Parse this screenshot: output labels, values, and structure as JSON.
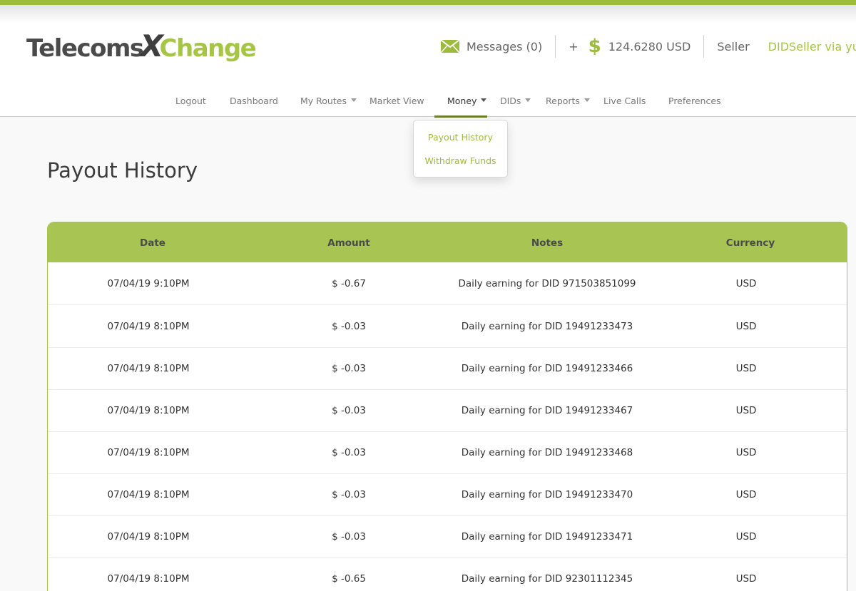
{
  "brand": {
    "logo_part1": "Telecoms",
    "logo_x": "X",
    "logo_part2": "Change",
    "accent_color": "#a6c545",
    "header_color": "#a8c553"
  },
  "header": {
    "messages_label": "Messages (0)",
    "plus_label": "+",
    "balance": "124.6280 USD",
    "role": "Seller",
    "user": "DIDSeller via yuri"
  },
  "nav": {
    "items": [
      {
        "label": "Logout"
      },
      {
        "label": "Dashboard"
      },
      {
        "label": "My Routes",
        "has_dropdown": true
      },
      {
        "label": "Market View"
      },
      {
        "label": "Money",
        "has_dropdown": true,
        "active": true
      },
      {
        "label": "DIDs",
        "has_dropdown": true
      },
      {
        "label": "Reports",
        "has_dropdown": true
      },
      {
        "label": "Live Calls"
      },
      {
        "label": "Preferences"
      }
    ]
  },
  "money_menu": {
    "items": [
      {
        "label": "Payout History"
      },
      {
        "label": "Withdraw Funds"
      }
    ]
  },
  "page": {
    "title": "Payout History"
  },
  "table": {
    "columns": [
      "Date",
      "Amount",
      "Notes",
      "Currency"
    ],
    "rows": [
      {
        "date": "07/04/19 9:10PM",
        "amount": "$ -0.67",
        "notes": "Daily earning for DID 971503851099",
        "currency": "USD"
      },
      {
        "date": "07/04/19 8:10PM",
        "amount": "$ -0.03",
        "notes": "Daily earning for DID 19491233473",
        "currency": "USD"
      },
      {
        "date": "07/04/19 8:10PM",
        "amount": "$ -0.03",
        "notes": "Daily earning for DID 19491233466",
        "currency": "USD"
      },
      {
        "date": "07/04/19 8:10PM",
        "amount": "$ -0.03",
        "notes": "Daily earning for DID 19491233467",
        "currency": "USD"
      },
      {
        "date": "07/04/19 8:10PM",
        "amount": "$ -0.03",
        "notes": "Daily earning for DID 19491233468",
        "currency": "USD"
      },
      {
        "date": "07/04/19 8:10PM",
        "amount": "$ -0.03",
        "notes": "Daily earning for DID 19491233470",
        "currency": "USD"
      },
      {
        "date": "07/04/19 8:10PM",
        "amount": "$ -0.03",
        "notes": "Daily earning for DID 19491233471",
        "currency": "USD"
      },
      {
        "date": "07/04/19 8:10PM",
        "amount": "$ -0.65",
        "notes": "Daily earning for DID 92301112345",
        "currency": "USD"
      }
    ]
  }
}
